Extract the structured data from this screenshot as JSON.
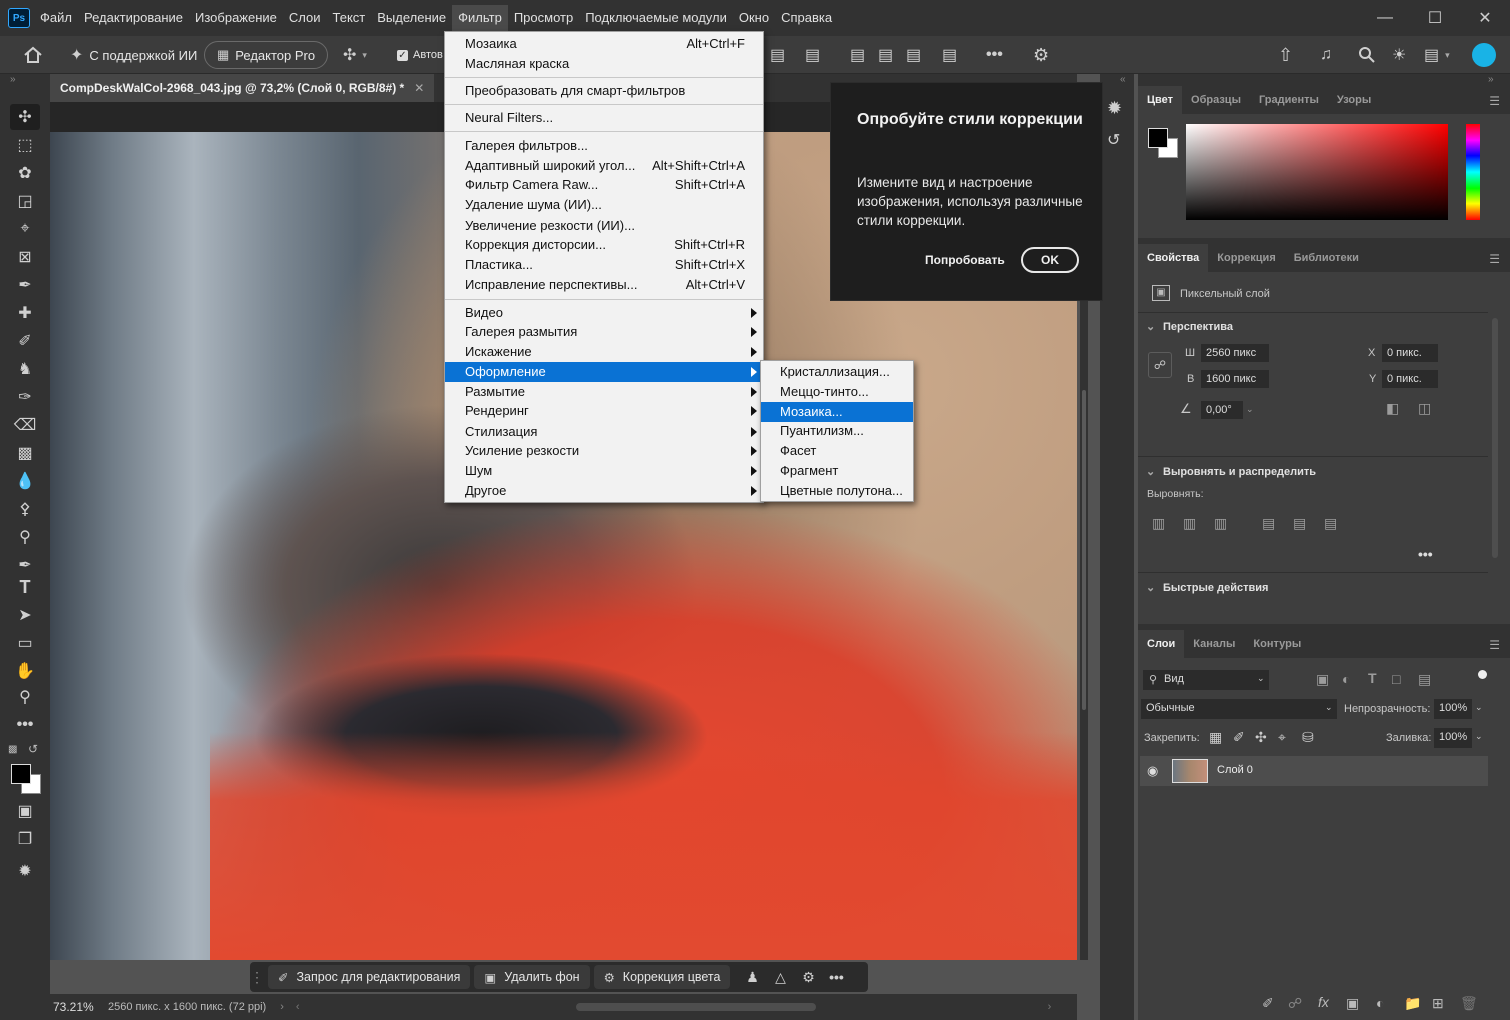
{
  "menubar": {
    "logo": "Ps",
    "items": [
      "Файл",
      "Редактирование",
      "Изображение",
      "Слои",
      "Текст",
      "Выделение",
      "Фильтр",
      "Просмотр",
      "Подключаемые модули",
      "Окно",
      "Справка"
    ]
  },
  "options": {
    "ai_assist": "С поддержкой ИИ",
    "editor_pro": "Редактор Pro",
    "auto_label": "Автов"
  },
  "document": {
    "tab_title": "CompDeskWalCol-2968_043.jpg @ 73,2% (Слой 0, RGB/8#) *",
    "zoom": "73.21%",
    "info": "2560 пикс. x 1600 пикс. (72 ppi)"
  },
  "filter_menu": {
    "items": [
      {
        "label": "Мозаика",
        "shortcut": "Alt+Ctrl+F"
      },
      {
        "label": "Масляная краска",
        "shortcut": ""
      },
      {
        "label": "Преобразовать для смарт-фильтров",
        "shortcut": ""
      },
      {
        "label": "Neural Filters...",
        "shortcut": ""
      },
      {
        "label": "Галерея фильтров...",
        "shortcut": ""
      },
      {
        "label": "Адаптивный широкий угол...",
        "shortcut": "Alt+Shift+Ctrl+A"
      },
      {
        "label": "Фильтр Camera Raw...",
        "shortcut": "Shift+Ctrl+A"
      },
      {
        "label": "Удаление шума (ИИ)...",
        "shortcut": ""
      },
      {
        "label": "Увеличение резкости (ИИ)...",
        "shortcut": ""
      },
      {
        "label": "Коррекция дисторсии...",
        "shortcut": "Shift+Ctrl+R"
      },
      {
        "label": "Пластика...",
        "shortcut": "Shift+Ctrl+X"
      },
      {
        "label": "Исправление перспективы...",
        "shortcut": "Alt+Ctrl+V"
      },
      {
        "label": "Видео",
        "shortcut": ""
      },
      {
        "label": "Галерея размытия",
        "shortcut": ""
      },
      {
        "label": "Искажение",
        "shortcut": ""
      },
      {
        "label": "Оформление",
        "shortcut": ""
      },
      {
        "label": "Размытие",
        "shortcut": ""
      },
      {
        "label": "Рендеринг",
        "shortcut": ""
      },
      {
        "label": "Стилизация",
        "shortcut": ""
      },
      {
        "label": "Усиление резкости",
        "shortcut": ""
      },
      {
        "label": "Шум",
        "shortcut": ""
      },
      {
        "label": "Другое",
        "shortcut": ""
      }
    ]
  },
  "submenu": {
    "items": [
      "Кристаллизация...",
      "Меццо-тинто...",
      "Мозаика...",
      "Пуантилизм...",
      "Фасет",
      "Фрагмент",
      "Цветные полутона..."
    ]
  },
  "popup": {
    "title": "Опробуйте стили коррекции",
    "body": "Измените вид и настроение изображения, используя различные стили коррекции.",
    "try_label": "Попробовать",
    "ok_label": "OK"
  },
  "color_panel": {
    "tabs": [
      "Цвет",
      "Образцы",
      "Градиенты",
      "Узоры"
    ],
    "foreground": "#000000",
    "background": "#ffffff"
  },
  "properties": {
    "tabs": [
      "Свойства",
      "Коррекция",
      "Библиотеки"
    ],
    "layer_type": "Пиксельный слой",
    "perspective_title": "Перспектива",
    "w_label": "Ш",
    "w_value": "2560 пикс",
    "h_label": "В",
    "h_value": "1600 пикс",
    "x_label": "X",
    "x_value": "0 пикс.",
    "y_label": "Y",
    "y_value": "0 пикс.",
    "angle_value": "0,00°",
    "align_title": "Выровнять и распределить",
    "align_label": "Выровнять:",
    "quick_actions_title": "Быстрые действия"
  },
  "layers": {
    "tabs": [
      "Слои",
      "Каналы",
      "Контуры"
    ],
    "filter_kind": "Вид",
    "blend_mode": "Обычные",
    "opacity_label": "Непрозрачность:",
    "opacity_value": "100%",
    "lock_label": "Закрепить:",
    "fill_label": "Заливка:",
    "fill_value": "100%",
    "layer_name": "Слой 0"
  },
  "taskbar": {
    "prompt_label": "Запрос для редактирования",
    "remove_bg_label": "Удалить фон",
    "color_correct_label": "Коррекция цвета"
  }
}
